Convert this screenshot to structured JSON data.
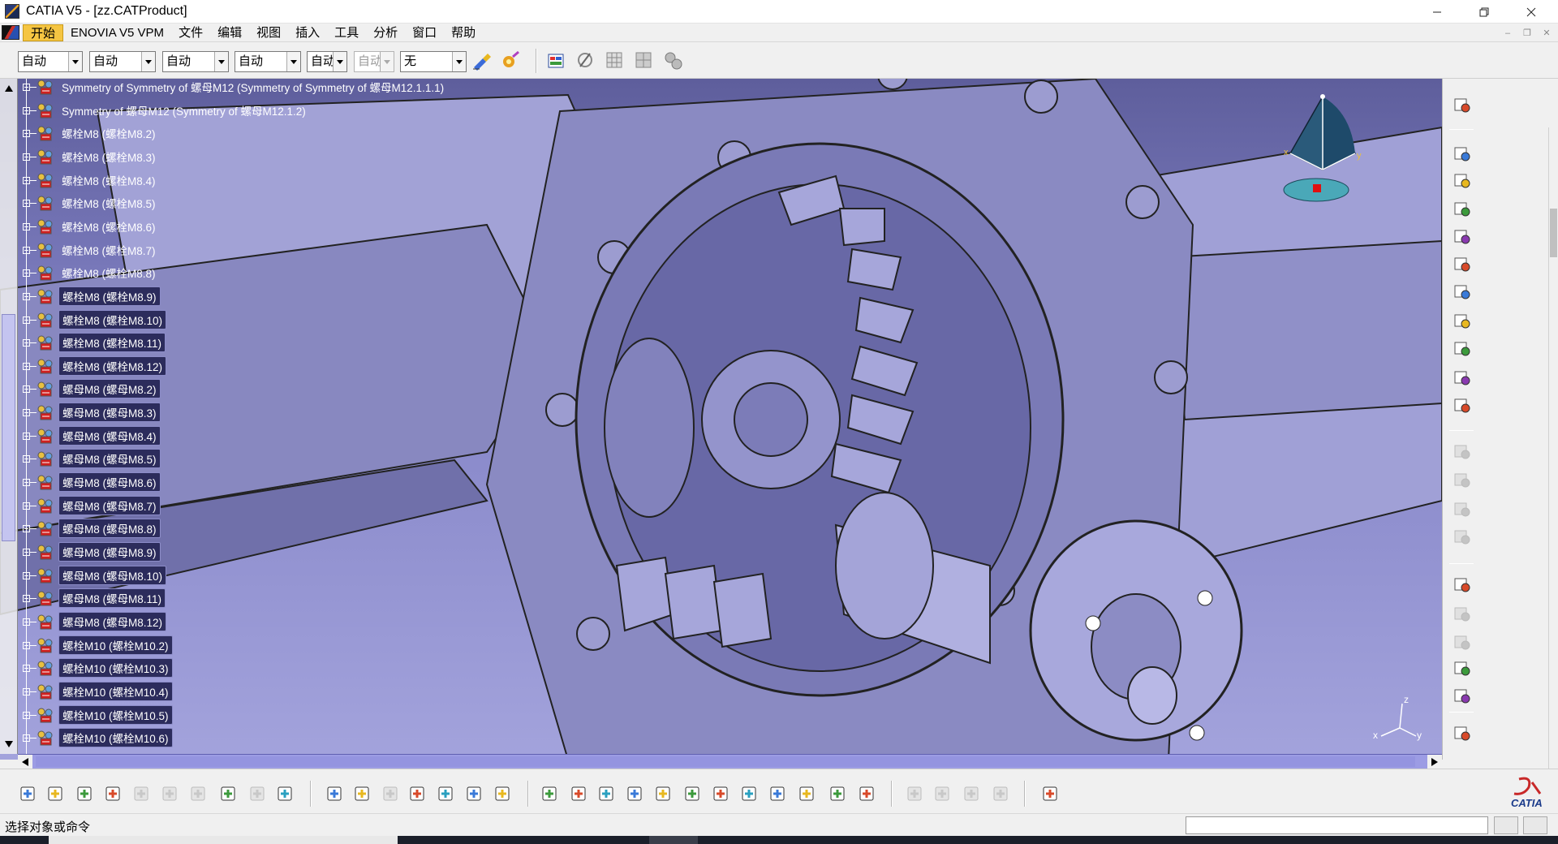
{
  "window": {
    "title": "CATIA V5 - [zz.CATProduct]"
  },
  "menu": {
    "items": [
      "开始",
      "ENOVIA V5 VPM",
      "文件",
      "编辑",
      "视图",
      "插入",
      "工具",
      "分析",
      "窗口",
      "帮助"
    ]
  },
  "toolbar": {
    "combos": [
      "自动",
      "自动",
      "自动",
      "自动",
      "自动",
      "自动",
      "无"
    ]
  },
  "tree": {
    "items": [
      "Symmetry of Symmetry of 螺母M12 (Symmetry of Symmetry of 螺母M12.1.1.1)",
      "Symmetry of 螺母M12 (Symmetry of 螺母M12.1.2)",
      "螺栓M8 (螺栓M8.2)",
      "螺栓M8 (螺栓M8.3)",
      "螺栓M8 (螺栓M8.4)",
      "螺栓M8 (螺栓M8.5)",
      "螺栓M8 (螺栓M8.6)",
      "螺栓M8 (螺栓M8.7)",
      "螺栓M8 (螺栓M8.8)",
      "螺栓M8 (螺栓M8.9)",
      "螺栓M8 (螺栓M8.10)",
      "螺栓M8 (螺栓M8.11)",
      "螺栓M8 (螺栓M8.12)",
      "螺母M8 (螺母M8.2)",
      "螺母M8 (螺母M8.3)",
      "螺母M8 (螺母M8.4)",
      "螺母M8 (螺母M8.5)",
      "螺母M8 (螺母M8.6)",
      "螺母M8 (螺母M8.7)",
      "螺母M8 (螺母M8.8)",
      "螺母M8 (螺母M8.9)",
      "螺母M8 (螺母M8.10)",
      "螺母M8 (螺母M8.11)",
      "螺母M8 (螺母M8.12)",
      "螺栓M10 (螺栓M10.2)",
      "螺栓M10 (螺栓M10.3)",
      "螺栓M10 (螺栓M10.4)",
      "螺栓M10 (螺栓M10.5)",
      "螺栓M10 (螺栓M10.6)"
    ]
  },
  "compass": {
    "x": "x",
    "y": "y"
  },
  "axis_triad": {
    "x": "x",
    "y": "y",
    "z": "z"
  },
  "status": {
    "message": "选择对象或命令"
  },
  "icons": {
    "top": [
      "paint-brush-icon",
      "magic-wand-icon",
      "catalog-icon",
      "constraint-icon",
      "grid-icon",
      "grid-alt-icon",
      "gear-cluster-icon"
    ],
    "right": [
      "select-icon",
      "gear-red-icon",
      "gear-blue-icon",
      "gear-yellow-icon",
      "arrow-box-icon",
      "scissors-icon",
      "replace-icon",
      "tree-icon",
      "tree-alt-icon",
      "text-icon",
      "product-icon",
      "disabled-1-icon",
      "disabled-2-icon",
      "disabled-3-icon",
      "disabled-4-icon",
      "explode-icon",
      "disabled-5-icon",
      "disabled-6-icon",
      "lightbulb-icon",
      "clash-icon",
      "catalog-browser-icon"
    ],
    "bottom": [
      "new-icon",
      "open-icon",
      "save-icon",
      "print-icon",
      "cut-icon",
      "copy-icon",
      "paste-icon",
      "undo-icon",
      "redo-icon",
      "whats-this-icon",
      "formula-icon",
      "comment-icon",
      "law-icon",
      "table-icon",
      "structure-icon",
      "lock-icon",
      "measure-icon",
      "fly-icon",
      "fit-all-icon",
      "pan-icon",
      "rotate-icon",
      "zoom-in-icon",
      "zoom-out-icon",
      "normal-view-icon",
      "multi-view-icon",
      "iso-view-icon",
      "render-style-icon",
      "hide-show-icon",
      "swap-icon",
      "disabled-7-icon",
      "disabled-8-icon",
      "disabled-9-icon",
      "disabled-10-icon",
      "camera-icon"
    ]
  },
  "colors": {
    "background_top": "#5e5e9c",
    "background_bottom": "#a3a3dc",
    "model": "#8e8ec8",
    "start_menu": "#f5c542"
  }
}
